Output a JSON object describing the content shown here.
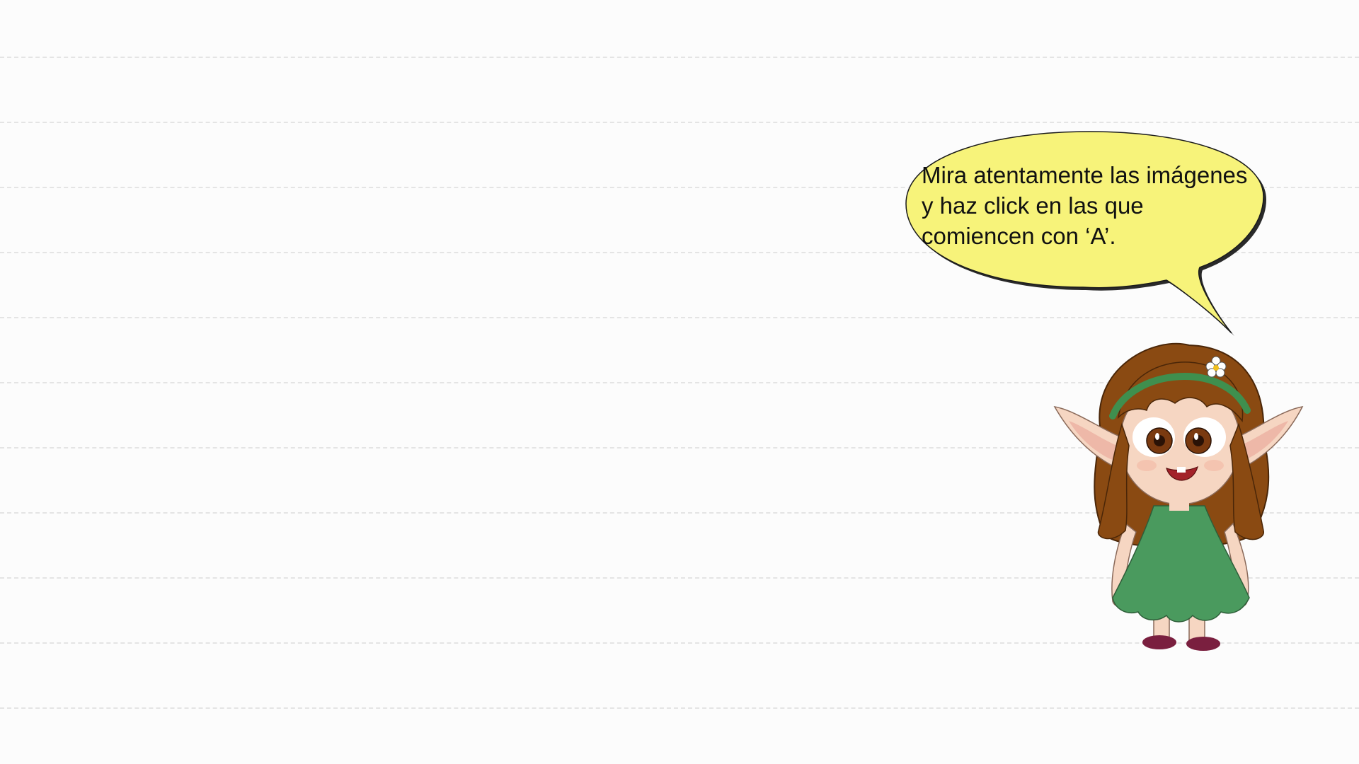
{
  "speech_bubble": {
    "lines": [
      "Mira atentamente las imágenes",
      "y haz click en las que",
      "comiencen con ‘A’."
    ],
    "fill_color": "#f7f37a",
    "outline_color": "#1a1a1a"
  },
  "character": {
    "icon": "elf-girl-character",
    "hair_color": "#8a4a12",
    "dress_color": "#4a9a5e",
    "headband_color": "#3f8f4e",
    "skin_color": "#f6d6c2",
    "shoe_color": "#7a1f3f"
  },
  "background": {
    "style": "ruled-notebook-paper",
    "line_color": "#e4e4e4"
  }
}
